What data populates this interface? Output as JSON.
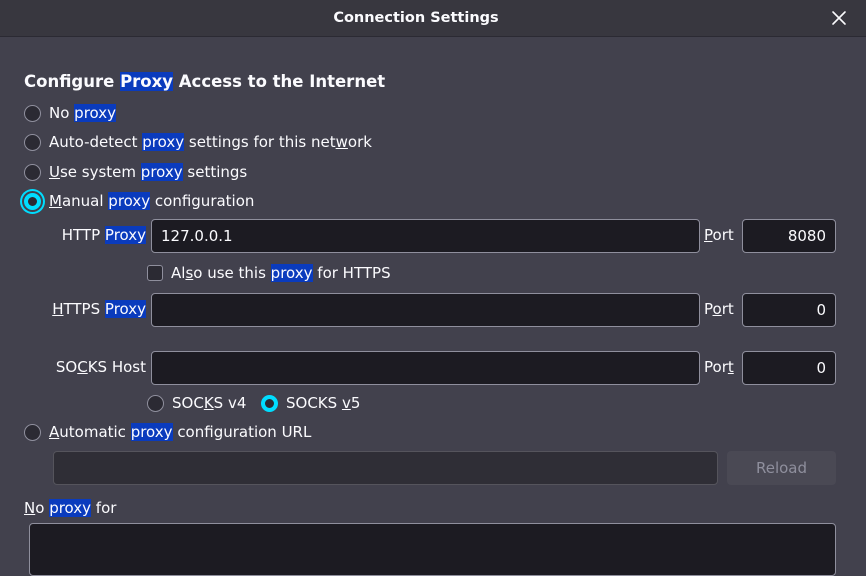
{
  "window": {
    "title": "Connection Settings"
  },
  "heading": {
    "pre": "Configure ",
    "hl": "Proxy",
    "post": " Access to the Internet"
  },
  "options": {
    "no_proxy": {
      "a": "No ",
      "hl": "proxy",
      "selected": false
    },
    "auto_detect": {
      "a": "Auto-detect ",
      "hl": "proxy",
      "b": " settings for this net",
      "u": "w",
      "c": "ork",
      "selected": false
    },
    "system": {
      "u": "U",
      "a": "se system ",
      "hl": "proxy",
      "b": " settings",
      "selected": false
    },
    "manual": {
      "u": "M",
      "a": "anual ",
      "hl": "proxy",
      "b": " configuration",
      "selected": true
    },
    "auto_url": {
      "u": "A",
      "a": "utomatic ",
      "hl": "proxy",
      "b": " configuration URL",
      "selected": false
    }
  },
  "http": {
    "label_a": "HTTP ",
    "label_hl": "Proxy",
    "value": "127.0.0.1",
    "port_u": "P",
    "port_rest": "ort",
    "port_value": "8080"
  },
  "also_https": {
    "a": "Al",
    "u": "s",
    "b": "o use this ",
    "hl": "proxy",
    "c": " for HTTPS",
    "checked": false
  },
  "https": {
    "label_u": "H",
    "label_a": "TTPS ",
    "label_hl": "Proxy",
    "value": "",
    "port_a": "P",
    "port_u": "o",
    "port_rest": "rt",
    "port_value": "0"
  },
  "socks": {
    "label_a": "SO",
    "label_u": "C",
    "label_b": "KS Host",
    "value": "",
    "port_a": "Por",
    "port_u": "t",
    "port_value": "0",
    "v4_a": "SOC",
    "v4_u": "K",
    "v4_b": "S v4",
    "v5_a": "SOCKS ",
    "v5_u": "v",
    "v5_b": "5",
    "version_selected": "v5"
  },
  "auto_url_field": {
    "value": "",
    "reload_label": "Reload"
  },
  "no_proxy_for": {
    "u": "N",
    "a": "o ",
    "hl": "proxy",
    "b": " for",
    "value": ""
  },
  "colors": {
    "background": "#42414d",
    "titlebar": "#38373f",
    "field": "#1c1b22",
    "accent": "#00ddff",
    "highlight": "#0a3bbd"
  }
}
